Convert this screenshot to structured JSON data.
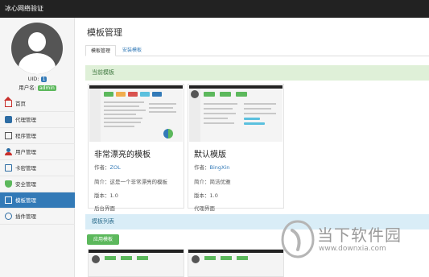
{
  "app": {
    "title": "冰心网络验证"
  },
  "sidebar": {
    "uid_label": "UID:",
    "uid_value": "1",
    "username_label": "用户名:",
    "username_value": "admin",
    "items": [
      {
        "label": "首页",
        "icon": "home-icon"
      },
      {
        "label": "代理管理",
        "icon": "agent-icon"
      },
      {
        "label": "程序管理",
        "icon": "program-icon"
      },
      {
        "label": "用户管理",
        "icon": "user-icon"
      },
      {
        "label": "卡密管理",
        "icon": "card-icon"
      },
      {
        "label": "安全管理",
        "icon": "shield-icon"
      },
      {
        "label": "模板管理",
        "icon": "template-icon",
        "active": true
      },
      {
        "label": "插件管理",
        "icon": "plugin-icon"
      }
    ]
  },
  "main": {
    "page_title": "模板管理",
    "tabs": [
      {
        "label": "模板管理",
        "active": true
      },
      {
        "label": "安装模板",
        "active": false
      }
    ],
    "current_section": "当前模板",
    "list_section": "模板列表",
    "apply_button": "应用模板",
    "cards": [
      {
        "title": "非常漂亮的模板",
        "author_label": "作者：",
        "author": "ZOL",
        "desc": "简介：这是一个非常漂亮的模板",
        "version": "版本：1.0",
        "type": "后台界面"
      },
      {
        "title": "默认模版",
        "author_label": "作者：",
        "author": "BingXin",
        "desc": "简介：简洁优雅",
        "version": "版本：1.0",
        "type": "代理界面"
      }
    ]
  },
  "watermark": {
    "text": "当下软件园",
    "url": "www.downxia.com"
  },
  "colors": {
    "primary": "#337ab7",
    "success": "#5cb85c",
    "topbar": "#222222"
  }
}
